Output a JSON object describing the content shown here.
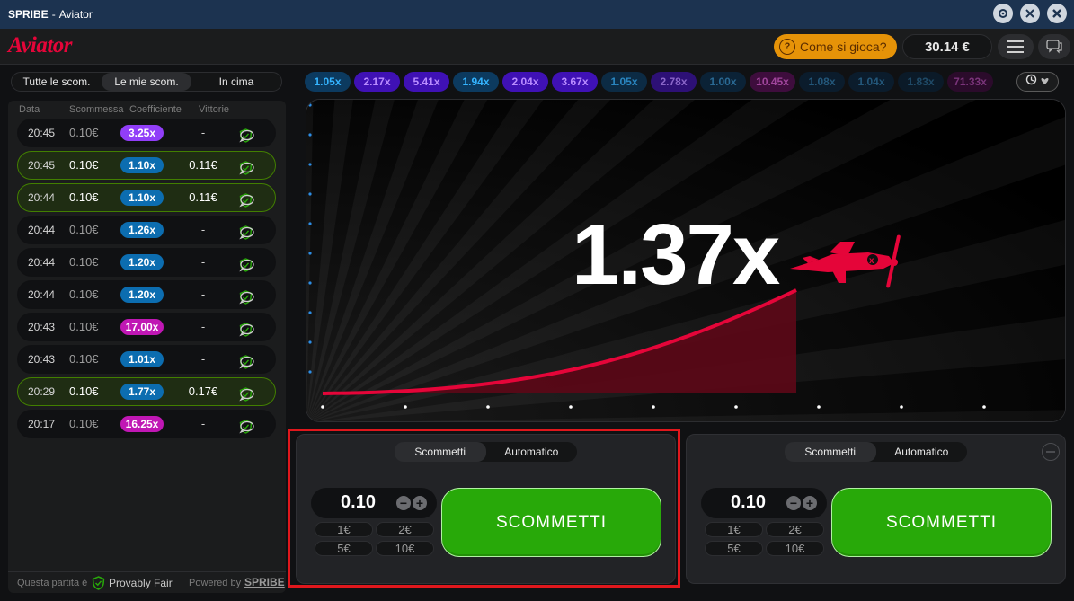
{
  "window": {
    "brand": "SPRIBE",
    "separator": "-",
    "title": "Aviator",
    "controls": [
      "settings-icon",
      "minimize-icon",
      "close-icon"
    ]
  },
  "header": {
    "logo": "Aviator",
    "how_to_play": "Come si gioca?",
    "balance": "30.14 €",
    "menu_icon": "hamburger-icon",
    "chat_icon": "chat-icon",
    "accent_color": "#e50539"
  },
  "left_tabs": [
    {
      "label": "Tutte le scom.",
      "active": false
    },
    {
      "label": "Le mie scom.",
      "active": true
    },
    {
      "label": "In cima",
      "active": false
    }
  ],
  "bets_table": {
    "columns": [
      "Data",
      "Scommessa",
      "Coefficiente",
      "Vittorie"
    ],
    "rows": [
      {
        "time": "20:45",
        "stake": "0.10€",
        "coef": "3.25x",
        "coef_color": "#913ef8",
        "cashout": "-",
        "won": false
      },
      {
        "time": "20:45",
        "stake": "0.10€",
        "coef": "1.10x",
        "coef_color": "#0c6db0",
        "cashout": "0.11€",
        "won": true
      },
      {
        "time": "20:44",
        "stake": "0.10€",
        "coef": "1.10x",
        "coef_color": "#0c6db0",
        "cashout": "0.11€",
        "won": true
      },
      {
        "time": "20:44",
        "stake": "0.10€",
        "coef": "1.26x",
        "coef_color": "#0c6db0",
        "cashout": "-",
        "won": false
      },
      {
        "time": "20:44",
        "stake": "0.10€",
        "coef": "1.20x",
        "coef_color": "#0c6db0",
        "cashout": "-",
        "won": false
      },
      {
        "time": "20:44",
        "stake": "0.10€",
        "coef": "1.20x",
        "coef_color": "#0c6db0",
        "cashout": "-",
        "won": false
      },
      {
        "time": "20:43",
        "stake": "0.10€",
        "coef": "17.00x",
        "coef_color": "#c017b4",
        "cashout": "-",
        "won": false
      },
      {
        "time": "20:43",
        "stake": "0.10€",
        "coef": "1.01x",
        "coef_color": "#0c6db0",
        "cashout": "-",
        "won": false
      },
      {
        "time": "20:29",
        "stake": "0.10€",
        "coef": "1.77x",
        "coef_color": "#0c6db0",
        "cashout": "0.17€",
        "won": true
      },
      {
        "time": "20:17",
        "stake": "0.10€",
        "coef": "16.25x",
        "coef_color": "#c017b4",
        "cashout": "-",
        "won": false
      }
    ]
  },
  "footer": {
    "provably_label": "Questa partita è",
    "provably_text": "Provably Fair",
    "powered_by": "Powered by",
    "provider": "SPRIBE"
  },
  "history": [
    {
      "value": "1.05x",
      "bg": "#0c3a5f",
      "fg": "#34b4ff"
    },
    {
      "value": "2.17x",
      "bg": "#3f11b5",
      "fg": "#b98cff"
    },
    {
      "value": "5.41x",
      "bg": "#3f11b5",
      "fg": "#b98cff"
    },
    {
      "value": "1.94x",
      "bg": "#0c3a5f",
      "fg": "#34b4ff"
    },
    {
      "value": "2.04x",
      "bg": "#3f11b5",
      "fg": "#b98cff"
    },
    {
      "value": "3.67x",
      "bg": "#3f11b5",
      "fg": "#b98cff"
    },
    {
      "value": "1.05x",
      "bg": "#0c2b44",
      "fg": "#2a86c0"
    },
    {
      "value": "2.78x",
      "bg": "#2d1076",
      "fg": "#8a66c8"
    },
    {
      "value": "1.00x",
      "bg": "#0b2236",
      "fg": "#2a6a95"
    },
    {
      "value": "10.45x",
      "bg": "#3e0d3d",
      "fg": "#a0459c"
    },
    {
      "value": "1.08x",
      "bg": "#0b1c2c",
      "fg": "#23577a"
    },
    {
      "value": "1.04x",
      "bg": "#0b1c2c",
      "fg": "#23577a"
    },
    {
      "value": "1.83x",
      "bg": "#0b1a28",
      "fg": "#1f4a67"
    },
    {
      "value": "71.33x",
      "bg": "#2b0b2b",
      "fg": "#7a347a"
    }
  ],
  "history_button_icons": [
    "history-icon",
    "chevron-down-icon"
  ],
  "game": {
    "multiplier": "1.37x",
    "curve_color": "#e50539",
    "plane_color": "#e50539"
  },
  "bet_panels": [
    {
      "tabs": [
        {
          "label": "Scommetti",
          "active": true
        },
        {
          "label": "Automatico",
          "active": false
        }
      ],
      "stake": "0.10",
      "quick": [
        "1€",
        "2€",
        "5€",
        "10€"
      ],
      "button": "SCOMMETTI",
      "highlighted": true
    },
    {
      "tabs": [
        {
          "label": "Scommetti",
          "active": true
        },
        {
          "label": "Automatico",
          "active": false
        }
      ],
      "stake": "0.10",
      "quick": [
        "1€",
        "2€",
        "5€",
        "10€"
      ],
      "button": "SCOMMETTI",
      "highlighted": false
    }
  ]
}
